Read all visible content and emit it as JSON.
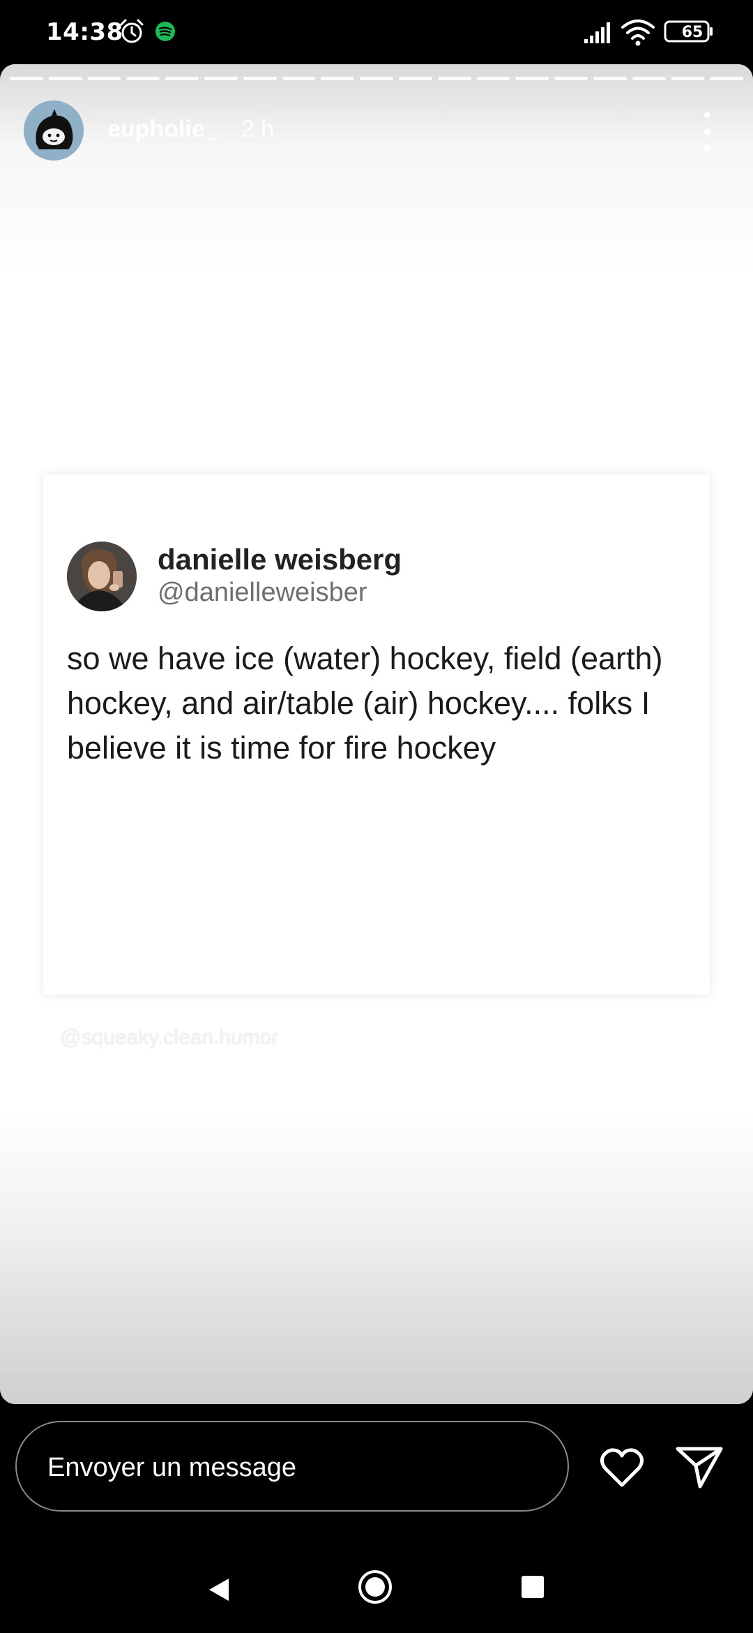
{
  "status_bar": {
    "time": "14:38",
    "battery": "65",
    "icons": [
      "alarm-icon",
      "spotify-icon",
      "signal-icon",
      "wifi-icon",
      "battery-icon"
    ]
  },
  "story": {
    "username": "eupholie_",
    "time_ago": "2 h",
    "progress_segments": 19,
    "tweet": {
      "author_name": "danielle weisberg",
      "author_handle": "@danielleweisber",
      "text": "so we have ice (water) hockey, field (earth) hockey, and air/table (air) hockey.... folks I believe it is time for fire hockey"
    },
    "watermark": "@squeaky.clean.humor"
  },
  "reply_bar": {
    "placeholder": "Envoyer un message"
  },
  "colors": {
    "background": "#000000",
    "story_bg": "#ffffff",
    "text_primary": "#1a1a1a",
    "handle_gray": "#6e6e6e",
    "spotify_green": "#1DB954"
  }
}
